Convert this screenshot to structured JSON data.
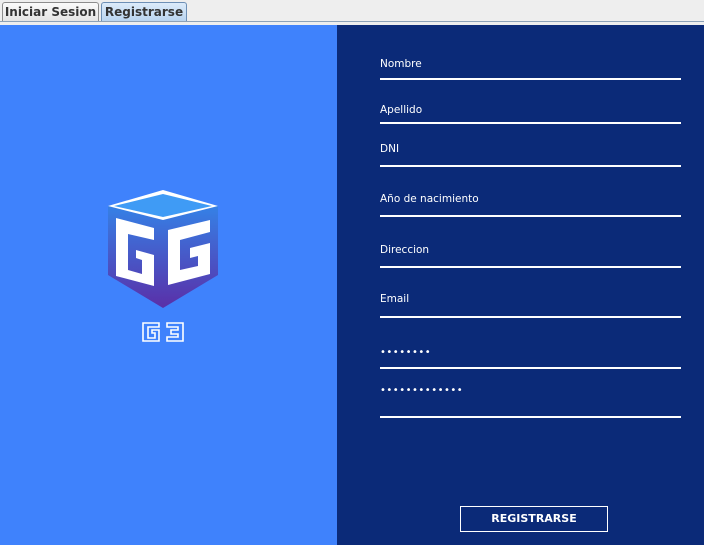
{
  "tabs": [
    {
      "label": "Iniciar Sesion",
      "selected": false
    },
    {
      "label": "Registrarse",
      "selected": true
    }
  ],
  "form": {
    "nombre_placeholder": "Nombre",
    "apellido_placeholder": "Apellido",
    "dni_placeholder": "DNI",
    "anio_placeholder": "Año de nacimiento",
    "direccion_placeholder": "Direccion",
    "email_placeholder": "Email",
    "password_mask": "••••••••",
    "confirm_password_mask": "•••••••••••••",
    "submit_label": "REGISTRARSE"
  },
  "colors": {
    "left_panel": "#3f82fc",
    "right_panel": "#0b2a78",
    "logo_gradient_top": "#2f8ef0",
    "logo_gradient_bottom": "#5a2fa8"
  },
  "logo": {
    "icon": "g3-cube-logo-icon",
    "caption": "G3"
  }
}
